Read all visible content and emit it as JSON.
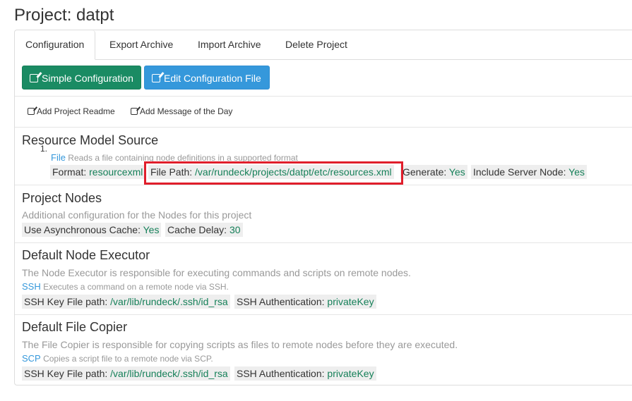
{
  "page": {
    "title": "Project: datpt"
  },
  "tabs": [
    {
      "label": "Configuration"
    },
    {
      "label": "Export Archive"
    },
    {
      "label": "Import Archive"
    },
    {
      "label": "Delete Project"
    }
  ],
  "buttons": {
    "simple": "Simple Configuration",
    "edit": "Edit Configuration File"
  },
  "links": {
    "readme": "Add Project Readme",
    "motd": "Add Message of the Day"
  },
  "resource_model": {
    "title": "Resource Model Source",
    "index": "1.",
    "provider": "File",
    "provider_desc": "Reads a file containing node definitions in a supported format",
    "props": [
      {
        "key": "Format: ",
        "value": "resourcexml"
      },
      {
        "key": "File Path: ",
        "value": "/var/rundeck/projects/datpt/etc/resources.xml"
      },
      {
        "key": "Generate: ",
        "value": "Yes"
      },
      {
        "key": "Include Server Node: ",
        "value": "Yes"
      }
    ],
    "highlight_color": "#e01e2b"
  },
  "project_nodes": {
    "title": "Project Nodes",
    "desc": "Additional configuration for the Nodes for this project",
    "props": [
      {
        "key": "Use Asynchronous Cache: ",
        "value": "Yes"
      },
      {
        "key": "Cache Delay: ",
        "value": "30"
      }
    ]
  },
  "node_executor": {
    "title": "Default Node Executor",
    "desc": "The Node Executor is responsible for executing commands and scripts on remote nodes.",
    "provider": "SSH",
    "provider_desc": "Executes a command on a remote node via SSH.",
    "props": [
      {
        "key": "SSH Key File path: ",
        "value": "/var/lib/rundeck/.ssh/id_rsa"
      },
      {
        "key": "SSH Authentication: ",
        "value": "privateKey"
      }
    ]
  },
  "file_copier": {
    "title": "Default File Copier",
    "desc": "The File Copier is responsible for copying scripts as files to remote nodes before they are executed.",
    "provider": "SCP",
    "provider_desc": "Copies a script file to a remote node via SCP.",
    "props": [
      {
        "key": "SSH Key File path: ",
        "value": "/var/lib/rundeck/.ssh/id_rsa"
      },
      {
        "key": "SSH Authentication: ",
        "value": "privateKey"
      }
    ]
  },
  "colors": {
    "green_button": "#1a8b63",
    "blue_button": "#3598db",
    "value_green": "#168059",
    "link_blue": "#3598db"
  }
}
